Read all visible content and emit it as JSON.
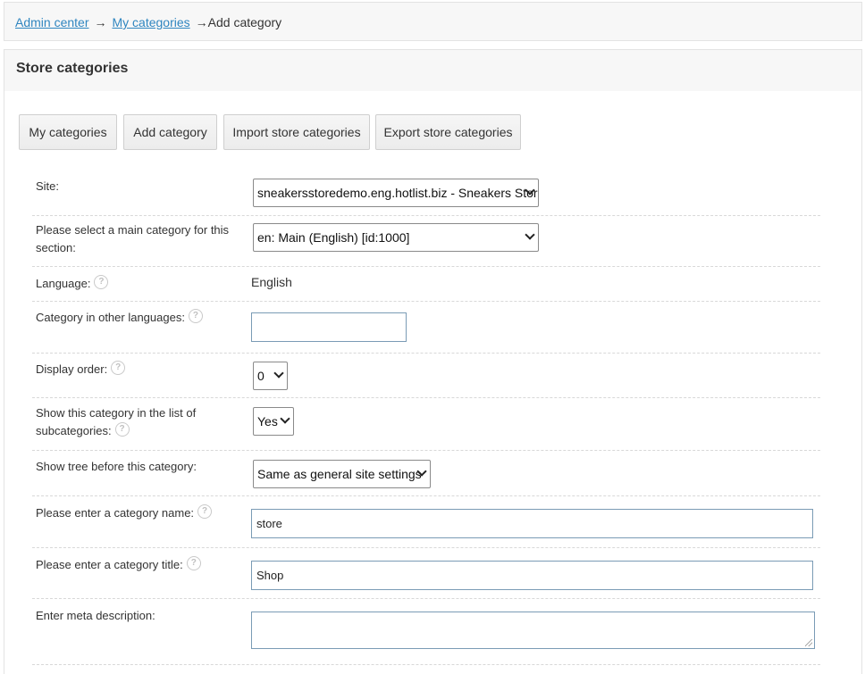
{
  "breadcrumb": {
    "items": [
      "Admin center",
      "My categories"
    ],
    "separator": "→",
    "current": "Add category"
  },
  "panel": {
    "title": "Store categories"
  },
  "tabs": [
    "My categories",
    "Add category",
    "Import store categories",
    "Export store categories"
  ],
  "form": {
    "site": {
      "label": "Site:",
      "value": "sneakersstoredemo.eng.hotlist.biz - Sneakers Stor"
    },
    "main_category": {
      "label": "Please select a main category for this section:",
      "value": "en: Main (English) [id:1000]"
    },
    "language": {
      "label": "Language:",
      "value": "English"
    },
    "other_languages": {
      "label": "Category in other languages:",
      "value": ""
    },
    "display_order": {
      "label": "Display order:",
      "value": "0"
    },
    "show_in_subcategories": {
      "label": "Show this category in the list of subcategories:",
      "value": "Yes"
    },
    "show_tree": {
      "label": "Show tree before this category:",
      "value": "Same as general site settings"
    },
    "category_name": {
      "label": "Please enter a category name:",
      "value": "store"
    },
    "category_title": {
      "label": "Please enter a category title:",
      "value": "Shop"
    },
    "meta_description": {
      "label": "Enter meta description:",
      "value": ""
    }
  },
  "colors": {
    "link": "#2f86c0",
    "header_bg": "#f7f7f7",
    "input_border": "#7a9bb5"
  },
  "icons": {
    "help": "question-circle-icon",
    "dropdown": "chevron-down-icon"
  }
}
